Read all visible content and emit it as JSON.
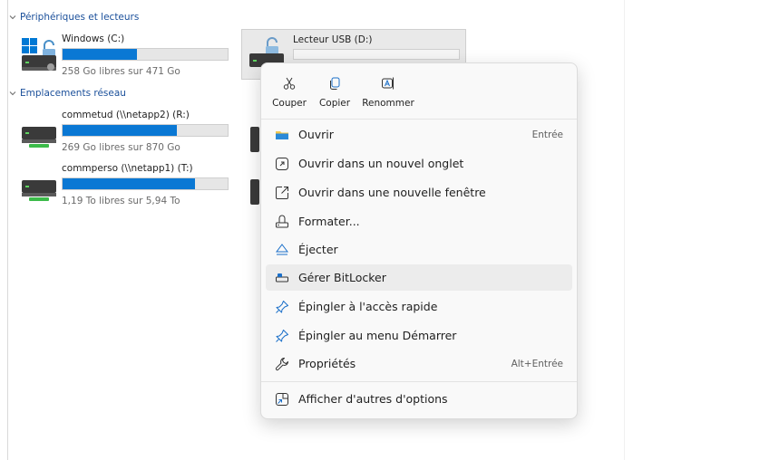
{
  "groups": {
    "devices_header": "Périphériques et lecteurs",
    "network_header": "Emplacements réseau"
  },
  "drives": [
    {
      "name": "Windows (C:)",
      "info": "258 Go libres sur 471 Go",
      "used_fraction": 0.45
    },
    {
      "name": "Lecteur USB (D:)",
      "used_fraction": 0.0
    }
  ],
  "network": [
    {
      "name": "commetud (\\\\netapp2) (R:)",
      "info": "269 Go libres sur 870 Go",
      "used_fraction": 0.69
    },
    {
      "name": "commperso (\\\\netapp1) (T:)",
      "info": "1,19 To libres sur 5,94 To",
      "used_fraction": 0.8
    }
  ],
  "quick_actions": [
    {
      "label": "Couper",
      "icon": "scissors-icon"
    },
    {
      "label": "Copier",
      "icon": "copy-icon"
    },
    {
      "label": "Renommer",
      "icon": "rename-icon"
    }
  ],
  "menu_items": [
    {
      "label": "Ouvrir",
      "shortcut": "Entrée",
      "icon": "folder-icon"
    },
    {
      "label": "Ouvrir dans un nouvel onglet",
      "icon": "new-tab-icon"
    },
    {
      "label": "Ouvrir dans une nouvelle fenêtre",
      "icon": "new-window-icon"
    },
    {
      "label": "Formater...",
      "icon": "format-icon"
    },
    {
      "label": "Éjecter",
      "icon": "eject-icon"
    },
    {
      "label": "Gérer BitLocker",
      "icon": "bitlocker-icon",
      "highlighted": true
    },
    {
      "label": "Épingler à l'accès rapide",
      "icon": "pin-icon"
    },
    {
      "label": "Épingler au menu Démarrer",
      "icon": "pin-icon"
    },
    {
      "label": "Propriétés",
      "shortcut": "Alt+Entrée",
      "icon": "wrench-icon"
    },
    {
      "label": "Afficher d'autres d'options",
      "icon": "more-options-icon"
    }
  ],
  "colors": {
    "accent": "#0a78d4",
    "link": "#1a4f9a",
    "menu_bg": "#f9f9f9",
    "highlight": "#ececec"
  }
}
